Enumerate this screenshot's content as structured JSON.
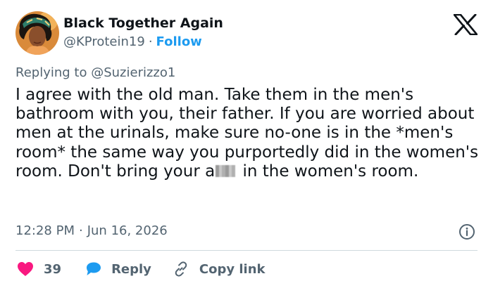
{
  "author": {
    "display_name": "Black Together Again",
    "handle": "@KProtein19",
    "separator": "·",
    "follow_label": "Follow"
  },
  "reply_context": {
    "prefix": "Replying to",
    "mention": "@Suzierizzo1"
  },
  "tweet": {
    "text_before_censor": "I agree with the old man. Take them in the men's bathroom with you, their father. If you are worried about men at the urinals, make sure no-one is in the *men's room* the same way you purportedly did in the women's room. Don't bring your a",
    "text_after_censor": " in the women's room."
  },
  "meta": {
    "time": "12:28 PM",
    "separator": "·",
    "date": "Jun 16, 2026"
  },
  "actions": {
    "like_count": "39",
    "reply_label": "Reply",
    "copy_link_label": "Copy link"
  },
  "colors": {
    "text": "#0f1419",
    "secondary": "#536471",
    "link": "#1d9bf0",
    "like": "#f91880",
    "divider": "#cfd9de"
  },
  "icons": [
    "avatar",
    "x-logo-icon",
    "info-icon",
    "heart-icon",
    "reply-bubble-icon",
    "link-icon"
  ]
}
